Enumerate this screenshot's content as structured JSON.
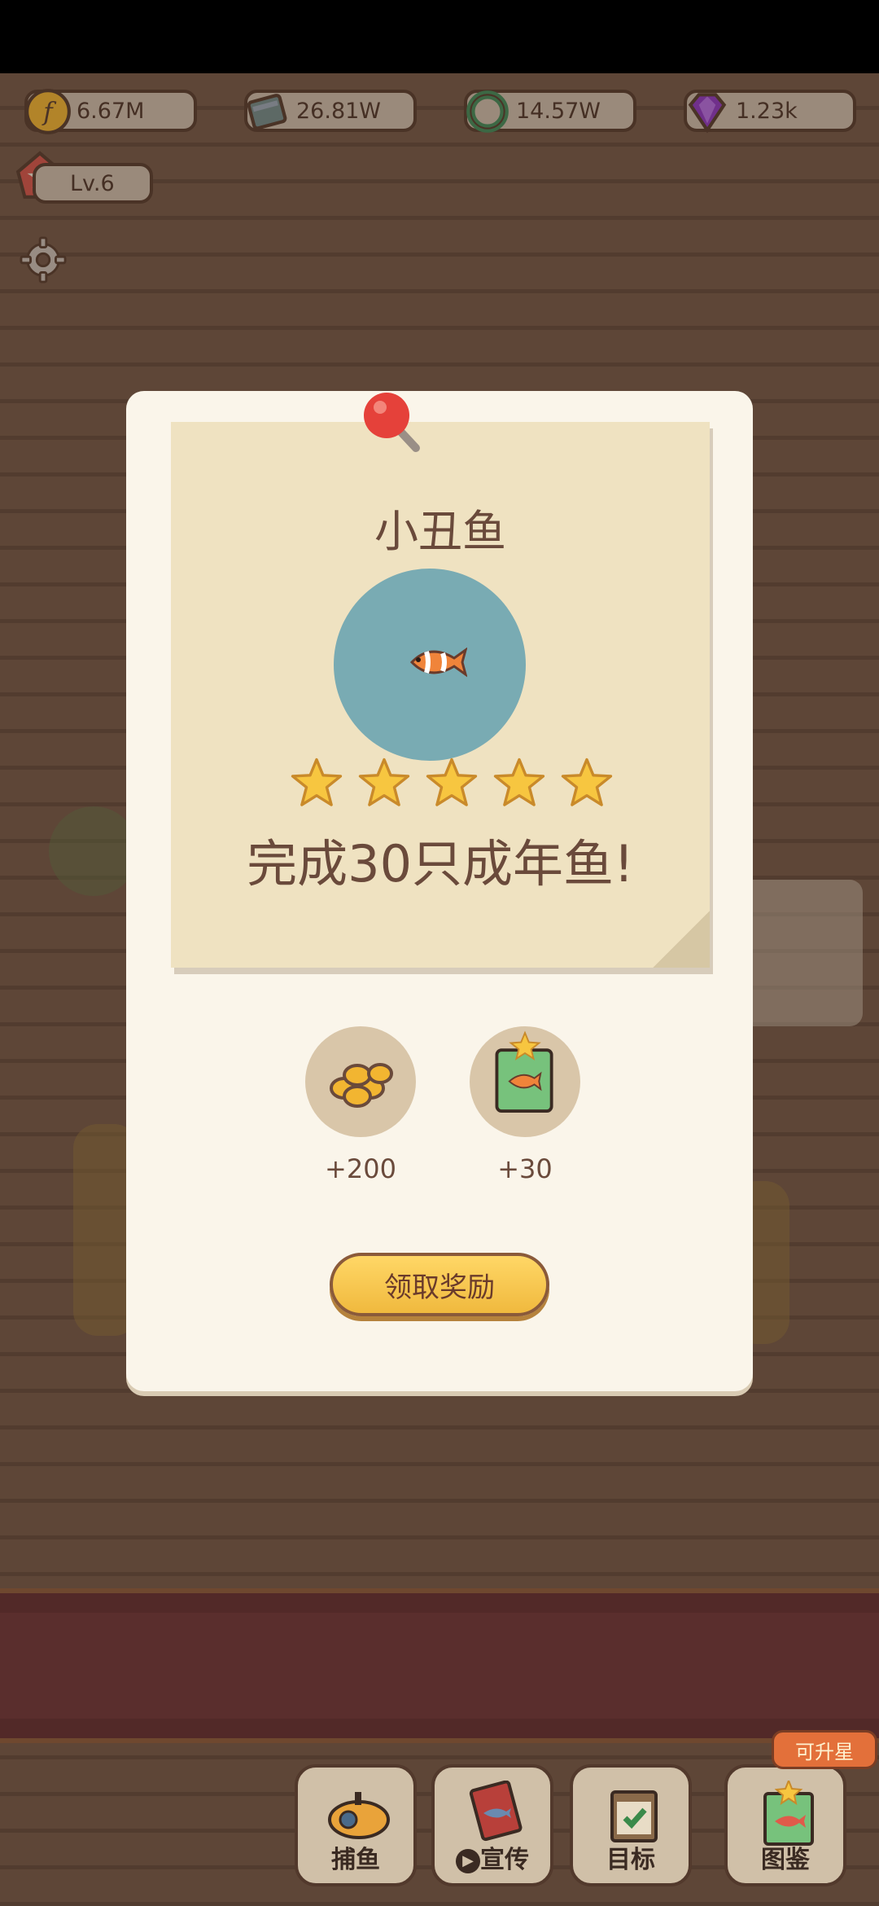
{
  "resources": [
    {
      "name": "coin",
      "value": "6.67M",
      "icon": "coin-icon"
    },
    {
      "name": "books",
      "value": "26.81W",
      "icon": "books-icon"
    },
    {
      "name": "gem-ring",
      "value": "14.57W",
      "icon": "ring-icon"
    },
    {
      "name": "diamond",
      "value": "1.23k",
      "icon": "diamond-icon"
    }
  ],
  "level": {
    "label": "Lv.6",
    "icon": "level-star-icon"
  },
  "settings": {
    "icon": "gear-icon"
  },
  "dialog": {
    "fish_name": "小丑鱼",
    "fish_icon": "clownfish-icon",
    "stars_filled": 5,
    "stars_total": 5,
    "task_text": "完成30只成年鱼!",
    "rewards": [
      {
        "icon": "coins-icon",
        "value": "+200"
      },
      {
        "icon": "fish-book-icon",
        "value": "+30"
      }
    ],
    "claim_label": "领取奖励"
  },
  "bottom_nav": [
    {
      "id": "catch",
      "label": "捕鱼",
      "icon": "submarine-icon"
    },
    {
      "id": "promote",
      "label": "宣传",
      "icon": "fish-card-icon",
      "prefix_icon": "play-icon"
    },
    {
      "id": "goals",
      "label": "目标",
      "icon": "checklist-icon"
    },
    {
      "id": "collection",
      "label": "图鉴",
      "icon": "fish-book-icon"
    }
  ],
  "collection_badge": "可升星",
  "colors": {
    "accent": "#f0b93e",
    "fish_circle": "#79abb3",
    "text": "#6a4a3b"
  }
}
